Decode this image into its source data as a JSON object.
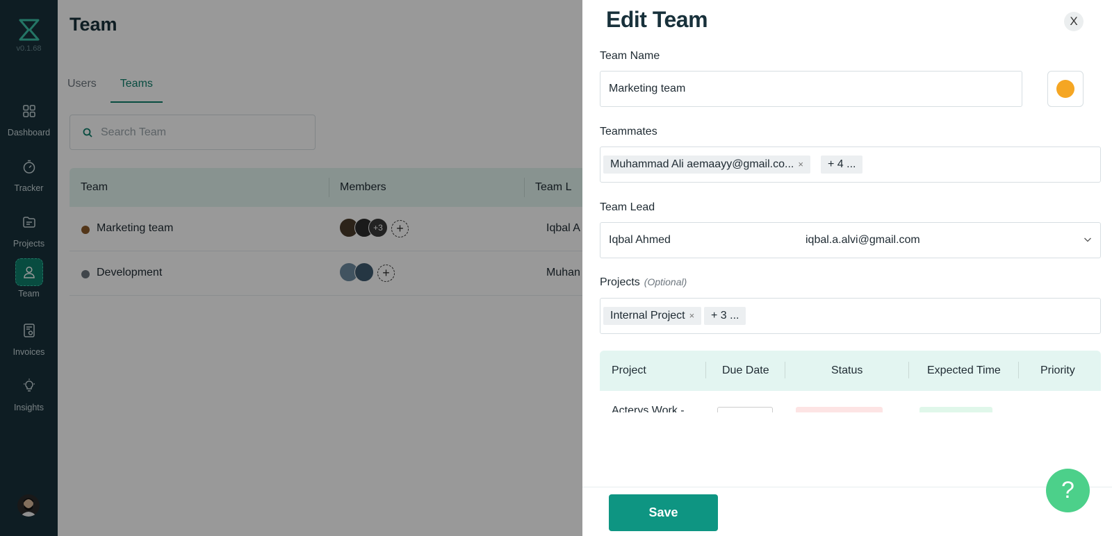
{
  "app": {
    "version": "v0.1.68"
  },
  "sidebar": {
    "items": [
      {
        "label": "Dashboard",
        "icon": "dashboard-icon"
      },
      {
        "label": "Tracker",
        "icon": "stopwatch-icon"
      },
      {
        "label": "Projects",
        "icon": "projects-icon"
      },
      {
        "label": "Team",
        "icon": "user-icon",
        "active": true
      },
      {
        "label": "Invoices",
        "icon": "invoice-icon"
      },
      {
        "label": "Insights",
        "icon": "lightbulb-icon"
      }
    ]
  },
  "page": {
    "title": "Team",
    "tabs": [
      {
        "label": "Users"
      },
      {
        "label": "Teams",
        "active": true
      }
    ],
    "search_placeholder": "Search Team",
    "table": {
      "columns": [
        "Team",
        "Members",
        "Team L"
      ],
      "rows": [
        {
          "name": "Marketing team",
          "color": "#8a5a2b",
          "extra_members": "+3",
          "lead": "Iqbal A"
        },
        {
          "name": "Development",
          "color": "#6c757d",
          "lead": "Muhan"
        }
      ]
    }
  },
  "drawer": {
    "title": "Edit Team",
    "close_label": "X",
    "team_name": {
      "label": "Team Name",
      "value": "Marketing team",
      "color": "#f5a623"
    },
    "teammates": {
      "label": "Teammates",
      "chip": "Muhammad Ali aemaayy@gmail.co...",
      "chip_remove": "×",
      "more": "+ 4 ..."
    },
    "team_lead": {
      "label": "Team Lead",
      "name": "Iqbal Ahmed",
      "email": "iqbal.a.alvi@gmail.com"
    },
    "projects": {
      "label": "Projects",
      "optional": "(Optional)",
      "chip": "Internal Project",
      "chip_remove": "×",
      "more": "+ 3 ..."
    },
    "projects_table": {
      "columns": [
        "Project",
        "Due Date",
        "Status",
        "Expected Time",
        "Priority"
      ],
      "first_row_project": "Acterys Work -"
    },
    "save_label": "Save",
    "help_label": "?"
  }
}
